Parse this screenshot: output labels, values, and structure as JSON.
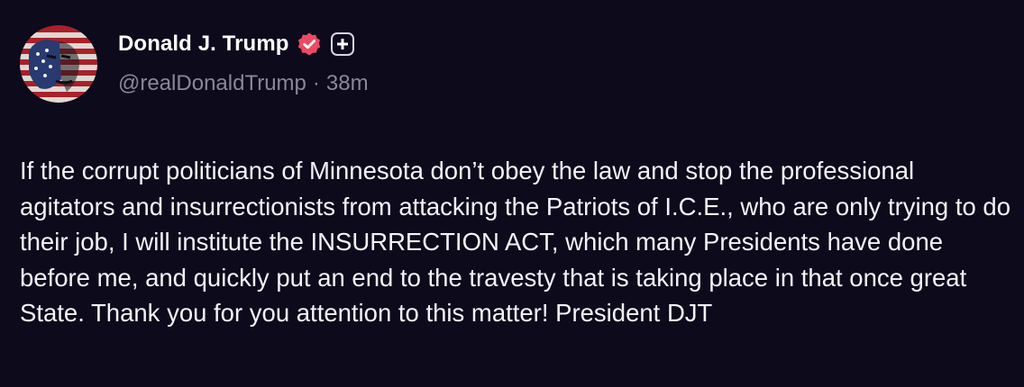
{
  "post": {
    "author": {
      "display_name": "Donald J. Trump",
      "handle": "@realDonaldTrump",
      "verified_icon": "verified-badge-icon",
      "plus_icon": "plus-badge-icon",
      "avatar": "flag-portrait-avatar"
    },
    "separator": "·",
    "timestamp": "38m",
    "text": "If the corrupt politicians of Minnesota don’t obey the law and stop the professional agitators and insurrectionists from attacking the Patriots of I.C.E., who are only trying to do their job, I will institute the INSURRECTION ACT, which many Presidents have done before me, and quickly put an end to the travesty that is taking place in that once great State. Thank you for you attention to this matter! President DJT"
  },
  "colors": {
    "background": "#0c0a1b",
    "text": "#f4f3f8",
    "muted": "#8a8799",
    "verified": "#ec4a64"
  }
}
